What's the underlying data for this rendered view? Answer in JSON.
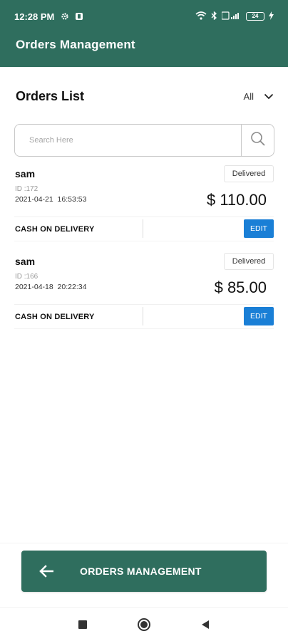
{
  "status_bar": {
    "time": "12:28 PM",
    "battery": "24"
  },
  "header": {
    "title": "Orders Management"
  },
  "orders_list": {
    "title": "Orders List",
    "filter_value": "All",
    "search_placeholder": "Search Here"
  },
  "orders": [
    {
      "name": "sam",
      "status": "Delivered",
      "id_text": "ID :172",
      "datetime": "2021-04-21  16:53:53",
      "amount": "$ 110.00",
      "payment": "CASH ON DELIVERY",
      "edit_label": "EDIT"
    },
    {
      "name": "sam",
      "status": "Delivered",
      "id_text": "ID :166",
      "datetime": "2021-04-18  20:22:34",
      "amount": "$ 85.00",
      "payment": "CASH ON DELIVERY",
      "edit_label": "EDIT"
    }
  ],
  "bottom_button": {
    "label": "ORDERS MANAGEMENT"
  },
  "colors": {
    "primary": "#2f6e5e",
    "edit": "#1a7fd6"
  },
  "icons": [
    "settings-icon",
    "notification-icon",
    "wifi-icon",
    "bluetooth-icon",
    "signal-icon",
    "battery-icon",
    "charging-icon",
    "chevron-down-icon",
    "search-icon",
    "back-arrow-icon",
    "nav-square-icon",
    "nav-circle-icon",
    "nav-triangle-icon"
  ]
}
